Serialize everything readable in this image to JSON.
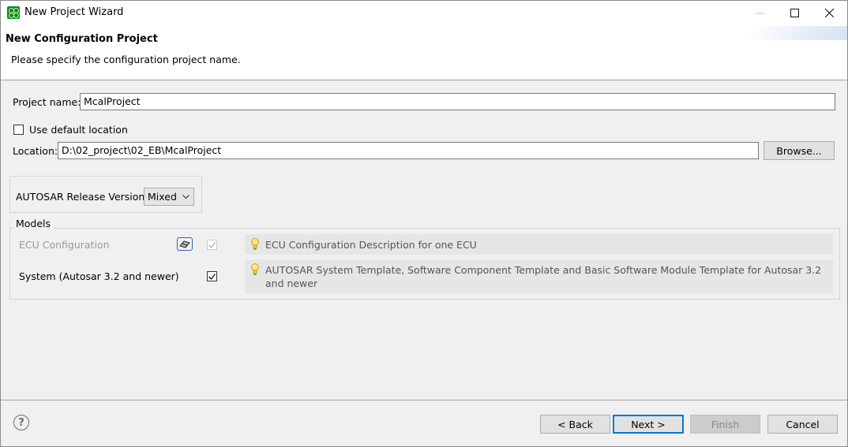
{
  "window": {
    "title": "New Project Wizard"
  },
  "header": {
    "title": "New Configuration Project",
    "description": "Please specify the configuration project name."
  },
  "form": {
    "project_name_label": "Project name:",
    "project_name_value": "McalProject",
    "use_default_location_label": "Use default location",
    "use_default_location_checked": false,
    "location_label": "Location:",
    "location_value": "D:\\02_project\\02_EB\\McalProject",
    "browse_label": "Browse...",
    "autosar_version_label": "AUTOSAR Release Version:",
    "autosar_version_value": "Mixed"
  },
  "models": {
    "group_label": "Models",
    "items": [
      {
        "name": "ECU Configuration",
        "enabled": false,
        "checked": true,
        "description": "ECU Configuration Description for one ECU"
      },
      {
        "name": "System (Autosar 3.2 and newer)",
        "enabled": true,
        "checked": true,
        "description": "AUTOSAR System Template, Software Component Template and Basic Software Module Template for Autosar 3.2 and newer"
      }
    ]
  },
  "footer": {
    "help_symbol": "?",
    "back_label": "< Back",
    "next_label": "Next >",
    "finish_label": "Finish",
    "cancel_label": "Cancel"
  },
  "colors": {
    "accent": "#0078d7",
    "app_icon": "#0b8a1f"
  }
}
